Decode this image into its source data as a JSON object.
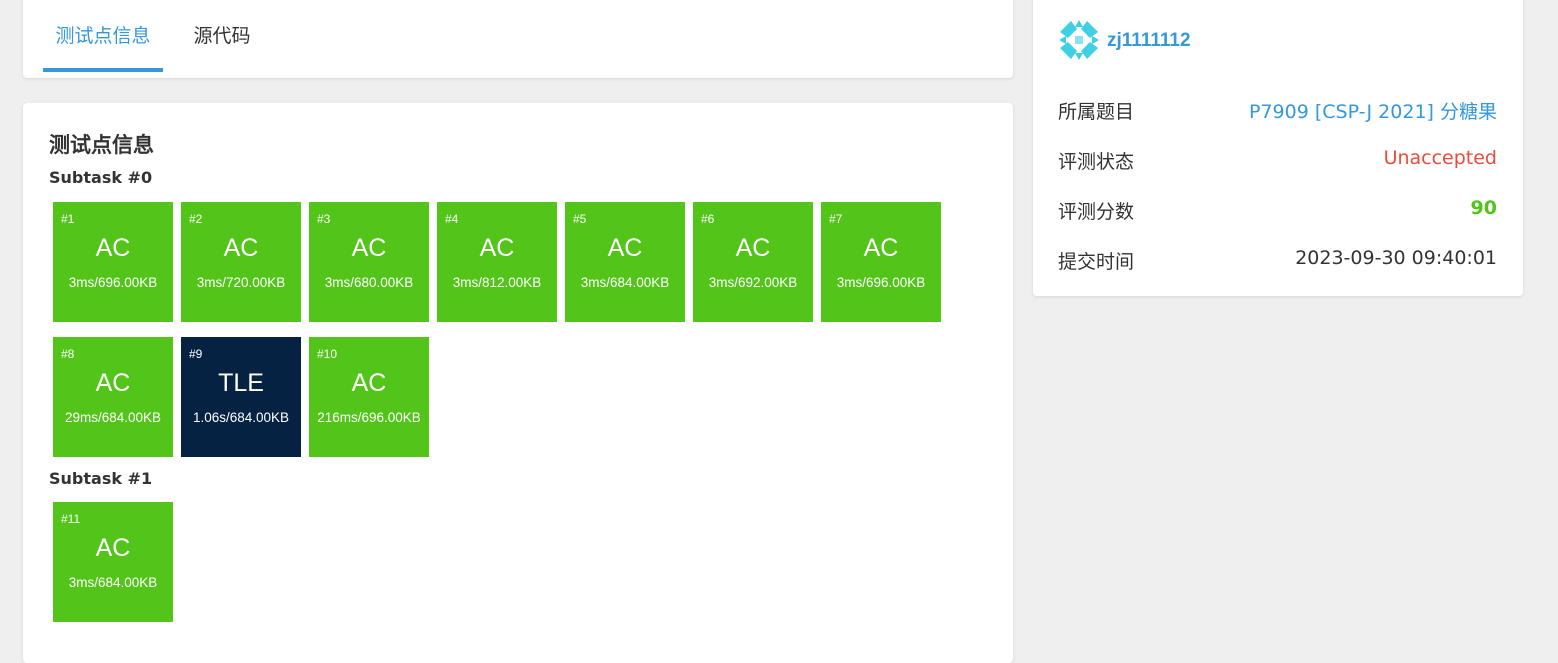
{
  "tabs": [
    {
      "label": "测试点信息",
      "active": true
    },
    {
      "label": "源代码",
      "active": false
    }
  ],
  "main": {
    "title": "测试点信息",
    "subtasks": [
      {
        "label": "Subtask #0",
        "cases": [
          {
            "id": "#1",
            "status": "AC",
            "info": "3ms/696.00KB"
          },
          {
            "id": "#2",
            "status": "AC",
            "info": "3ms/720.00KB"
          },
          {
            "id": "#3",
            "status": "AC",
            "info": "3ms/680.00KB"
          },
          {
            "id": "#4",
            "status": "AC",
            "info": "3ms/812.00KB"
          },
          {
            "id": "#5",
            "status": "AC",
            "info": "3ms/684.00KB"
          },
          {
            "id": "#6",
            "status": "AC",
            "info": "3ms/692.00KB"
          },
          {
            "id": "#7",
            "status": "AC",
            "info": "3ms/696.00KB"
          },
          {
            "id": "#8",
            "status": "AC",
            "info": "29ms/684.00KB"
          },
          {
            "id": "#9",
            "status": "TLE",
            "info": "1.06s/684.00KB"
          },
          {
            "id": "#10",
            "status": "AC",
            "info": "216ms/696.00KB"
          }
        ]
      },
      {
        "label": "Subtask #1",
        "cases": [
          {
            "id": "#11",
            "status": "AC",
            "info": "3ms/684.00KB"
          }
        ]
      }
    ]
  },
  "sidebar": {
    "avatar_icon": "identicon-avatar",
    "username": "zj1111112",
    "rows": [
      {
        "label": "所属题目",
        "value": "P7909 [CSP-J 2021] 分糖果"
      },
      {
        "label": "评测状态",
        "value": "Unaccepted"
      },
      {
        "label": "评测分数",
        "value": "90"
      },
      {
        "label": "提交时间",
        "value": "2023-09-30 09:40:01"
      }
    ]
  },
  "colors": {
    "accent": "#3498db",
    "ac": "#52c41a",
    "tle": "#052242",
    "unaccepted": "#e74c3c",
    "score": "#52c41a"
  }
}
